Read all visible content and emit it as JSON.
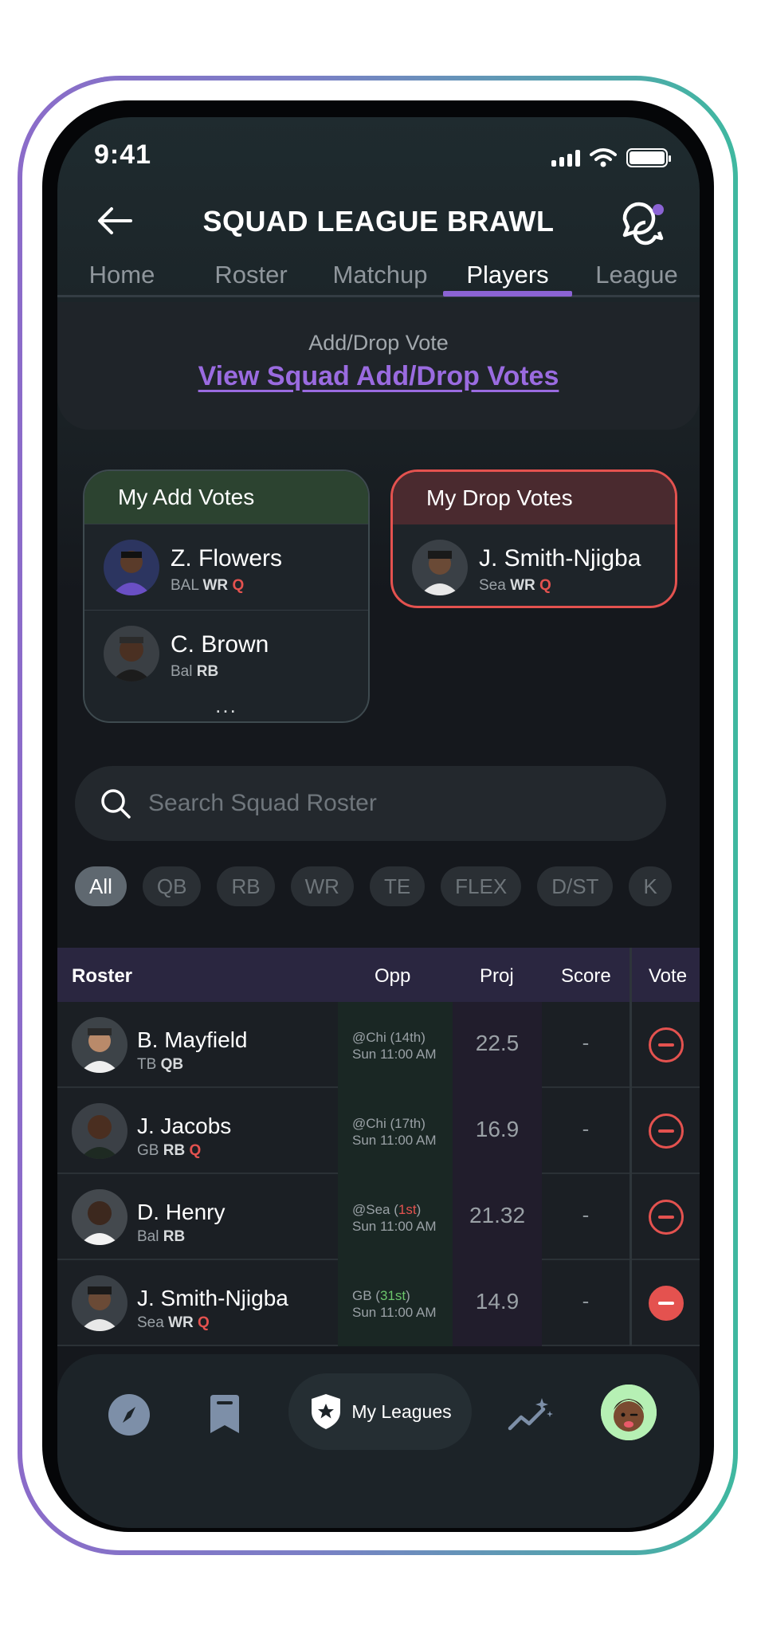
{
  "status": {
    "time": "9:41"
  },
  "header": {
    "title": "SQUAD LEAGUE BRAWL"
  },
  "tabs": [
    {
      "label": "Home",
      "active": false
    },
    {
      "label": "Roster",
      "active": false
    },
    {
      "label": "Matchup",
      "active": false
    },
    {
      "label": "Players",
      "active": true
    },
    {
      "label": "League",
      "active": false
    }
  ],
  "add_drop": {
    "label": "Add/Drop Vote",
    "link": "View Squad Add/Drop Votes"
  },
  "add_votes": {
    "title": "My Add Votes",
    "players": [
      {
        "name": "Z. Flowers",
        "team": "BAL",
        "pos": "WR",
        "status": "Q"
      },
      {
        "name": "C. Brown",
        "team": "Bal",
        "pos": "RB",
        "status": ""
      }
    ],
    "more": "..."
  },
  "drop_votes": {
    "title": "My Drop Votes",
    "players": [
      {
        "name": "J. Smith-Njigba",
        "team": "Sea",
        "pos": "WR",
        "status": "Q"
      }
    ]
  },
  "search": {
    "placeholder": "Search Squad Roster"
  },
  "filters": [
    {
      "label": "All",
      "active": true
    },
    {
      "label": "QB",
      "active": false
    },
    {
      "label": "RB",
      "active": false
    },
    {
      "label": "WR",
      "active": false
    },
    {
      "label": "TE",
      "active": false
    },
    {
      "label": "FLEX",
      "active": false
    },
    {
      "label": "D/ST",
      "active": false
    },
    {
      "label": "K",
      "active": false
    }
  ],
  "table": {
    "headers": {
      "roster": "Roster",
      "opp": "Opp",
      "proj": "Proj",
      "score": "Score",
      "vote": "Vote"
    },
    "rows": [
      {
        "name": "B. Mayfield",
        "team": "TB",
        "pos": "QB",
        "status": "",
        "opp": "@Chi",
        "opp_rank": "(14th)",
        "time": "Sun 11:00 AM",
        "proj": "22.5",
        "score": "-",
        "vote_selected": false
      },
      {
        "name": "J. Jacobs",
        "team": "GB",
        "pos": "RB",
        "status": "Q",
        "opp": "@Chi",
        "opp_rank": "(17th)",
        "time": "Sun 11:00 AM",
        "proj": "16.9",
        "score": "-",
        "vote_selected": false
      },
      {
        "name": "D. Henry",
        "team": "Bal",
        "pos": "RB",
        "status": "",
        "opp": "@Sea",
        "opp_rank_open": "(",
        "opp_rank": "1st",
        "opp_rank_close": ")",
        "time": "Sun 11:00 AM",
        "proj": "21.32",
        "score": "-",
        "vote_selected": false
      },
      {
        "name": "J. Smith-Njigba",
        "team": "Sea",
        "pos": "WR",
        "status": "Q",
        "opp": "GB",
        "opp_rank_open": "(",
        "opp_rank": "31st",
        "opp_rank_close": ")",
        "time": "Sun 11:00 AM",
        "proj": "14.9",
        "score": "-",
        "vote_selected": true
      }
    ]
  },
  "bottom_nav": {
    "active_label": "My Leagues"
  },
  "colors": {
    "accent": "#8b63d4",
    "danger": "#e4524f",
    "positive": "#6bc46b"
  }
}
